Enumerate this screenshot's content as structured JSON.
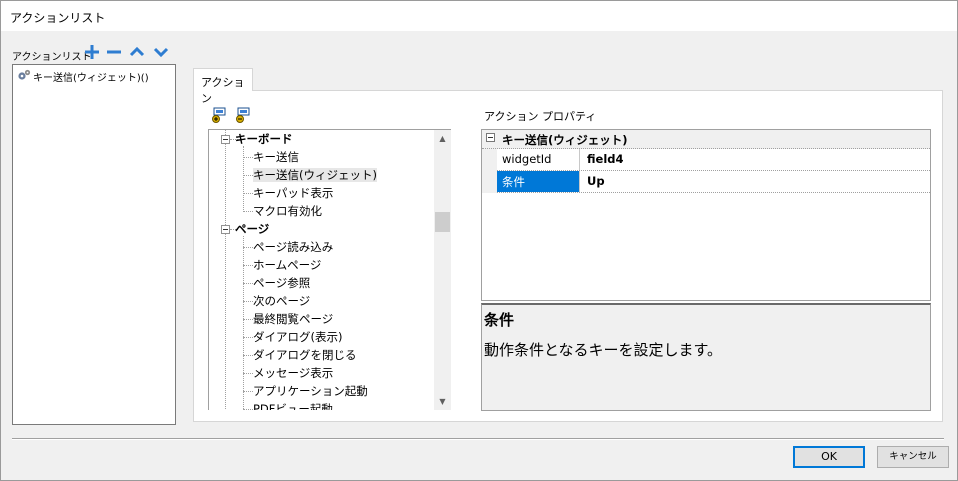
{
  "window": {
    "title": "アクションリスト"
  },
  "action_list": {
    "label": "アクションリスト",
    "items": [
      {
        "label": "キー送信(ウィジェット)()",
        "icon": "gears-icon"
      }
    ],
    "toolbar": {
      "add_icon": "plus-icon",
      "remove_icon": "minus-icon",
      "up_icon": "chevron-up-icon",
      "down_icon": "chevron-down-icon",
      "accent_color": "#2e7dd1"
    }
  },
  "tab": {
    "label": "アクション"
  },
  "tree": {
    "toolbar_icons": [
      "expand-all-icon",
      "collapse-all-icon"
    ],
    "categories": [
      {
        "label": "キーボード",
        "items": [
          "キー送信",
          "キー送信(ウィジェット)",
          "キーパッド表示",
          "マクロ有効化"
        ]
      },
      {
        "label": "ページ",
        "items": [
          "ページ読み込み",
          "ホームページ",
          "ページ参照",
          "次のページ",
          "最終閲覧ページ",
          "ダイアログ(表示)",
          "ダイアログを閉じる",
          "メッセージ表示",
          "アプリケーション起動",
          "PDFビュー起動"
        ]
      }
    ],
    "selected": "キー送信(ウィジェット)"
  },
  "properties": {
    "label": "アクション プロパティ",
    "category": "キー送信(ウィジェット)",
    "rows": [
      {
        "name": "widgetId",
        "value": "field4",
        "selected": false
      },
      {
        "name": "条件",
        "value": "Up",
        "selected": true
      }
    ],
    "selection_color": "#0078d7"
  },
  "help": {
    "title": "条件",
    "description": "動作条件となるキーを設定します。"
  },
  "buttons": {
    "ok": "OK",
    "cancel": "キャンセル"
  }
}
